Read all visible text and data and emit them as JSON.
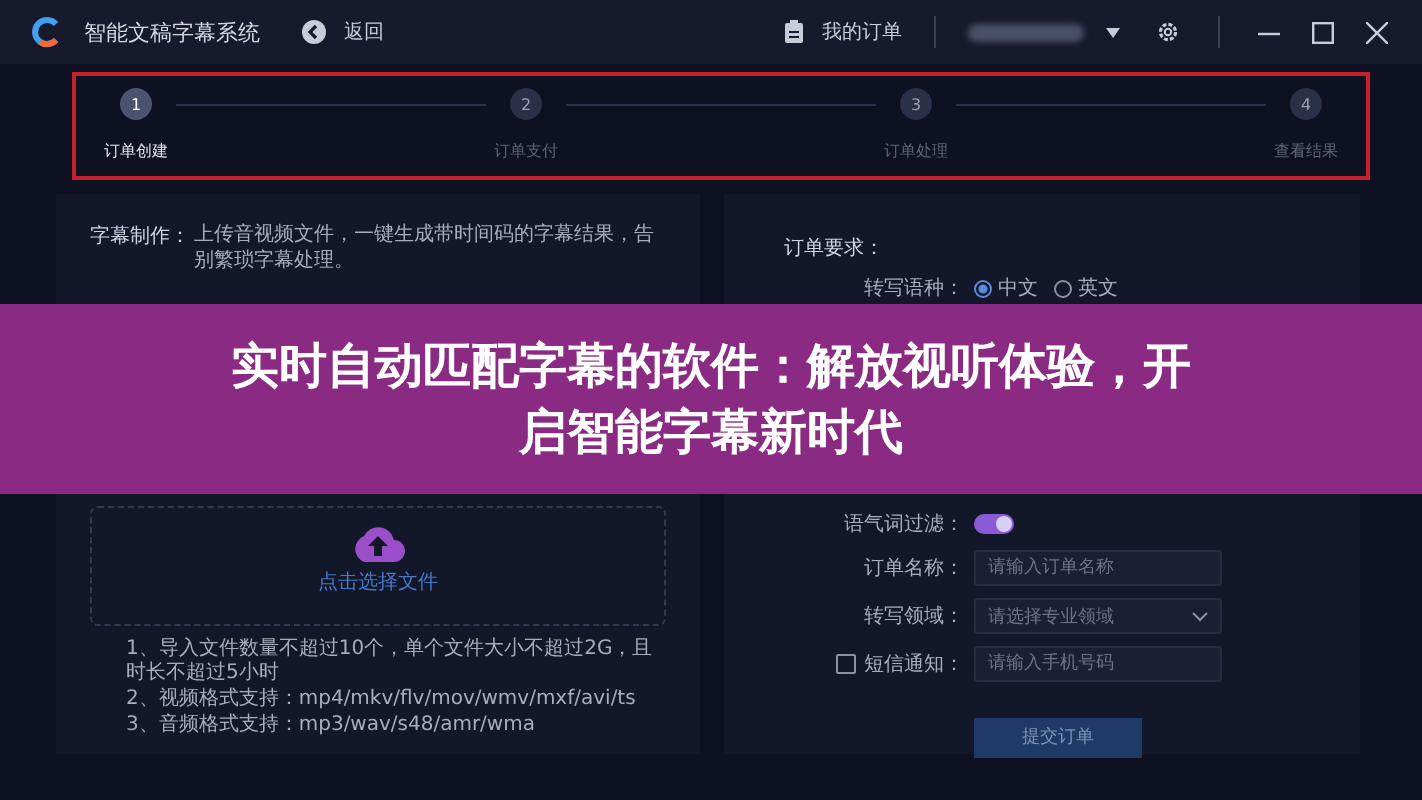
{
  "window": {
    "title": "智能文稿字幕系统"
  },
  "toolbar": {
    "back": "返回",
    "orders": "我的订单"
  },
  "steps": [
    {
      "number": "1",
      "label": "订单创建",
      "selected": true
    },
    {
      "number": "2",
      "label": "订单支付",
      "selected": false
    },
    {
      "number": "3",
      "label": "订单处理",
      "selected": false
    },
    {
      "number": "4",
      "label": "查看结果",
      "selected": false
    }
  ],
  "upload_panel": {
    "heading": "字幕制作：",
    "description": "上传音视频文件，一键生成带时间码的字幕结果，告别繁琐字幕处理。",
    "upload_label": "点击选择文件",
    "notes": [
      "1、导入文件数量不超过10个，单个文件大小不超过2G，且时长不超过5小时",
      "2、视频格式支持：mp4/mkv/flv/mov/wmv/mxf/avi/ts",
      "3、音频格式支持：mp3/wav/s48/amr/wma"
    ]
  },
  "order_panel": {
    "heading": "订单要求：",
    "fields": [
      {
        "kind": "radio",
        "label": "转写语种：",
        "options": [
          {
            "label": "中文",
            "selected": true
          },
          {
            "label": "英文",
            "selected": false
          }
        ]
      },
      {
        "kind": "toggle",
        "label": "语气词过滤：",
        "on": true
      },
      {
        "kind": "text",
        "label": "订单名称：",
        "placeholder": "请输入订单名称"
      },
      {
        "kind": "select",
        "label": "转写领域：",
        "placeholder": "请选择专业领域"
      },
      {
        "kind": "text",
        "label": "短信通知：",
        "placeholder": "请输入手机号码",
        "checkbox": {
          "checked": false
        }
      }
    ],
    "submit": "提交订单"
  },
  "banner": {
    "title": "实时自动匹配字幕的软件：解放视听体验，开启智能字幕新时代"
  }
}
